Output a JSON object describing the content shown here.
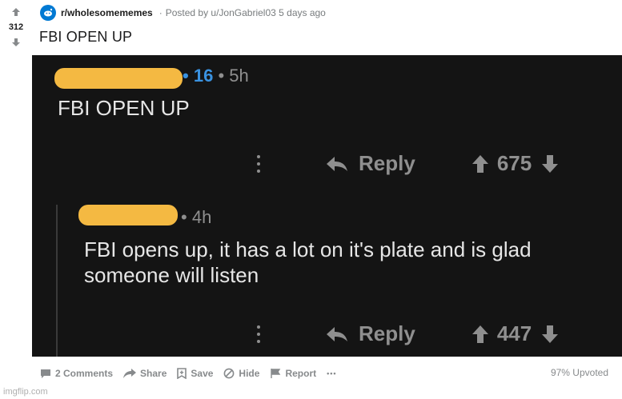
{
  "post": {
    "subreddit": "r/wholesomememes",
    "posted_by": "Posted by u/JonGabriel03 5 days ago",
    "title": "FBI OPEN UP",
    "score": "312"
  },
  "comments": [
    {
      "flair": "16",
      "age": "5h",
      "text": "FBI OPEN UP",
      "reply_label": "Reply",
      "score": "675"
    },
    {
      "age": "4h",
      "text_line1": "FBI opens up, it has a lot on it's plate and is glad",
      "text_line2": "someone will listen",
      "reply_label": "Reply",
      "score": "447"
    }
  ],
  "footer": {
    "comments": "2 Comments",
    "share": "Share",
    "save": "Save",
    "hide": "Hide",
    "report": "Report",
    "more": "•••",
    "upvoted": "97% Upvoted"
  },
  "watermark": "imgflip.com",
  "colors": {
    "accent": "#0079d3",
    "redaction": "#f4b942",
    "dark_bg": "#141414"
  }
}
